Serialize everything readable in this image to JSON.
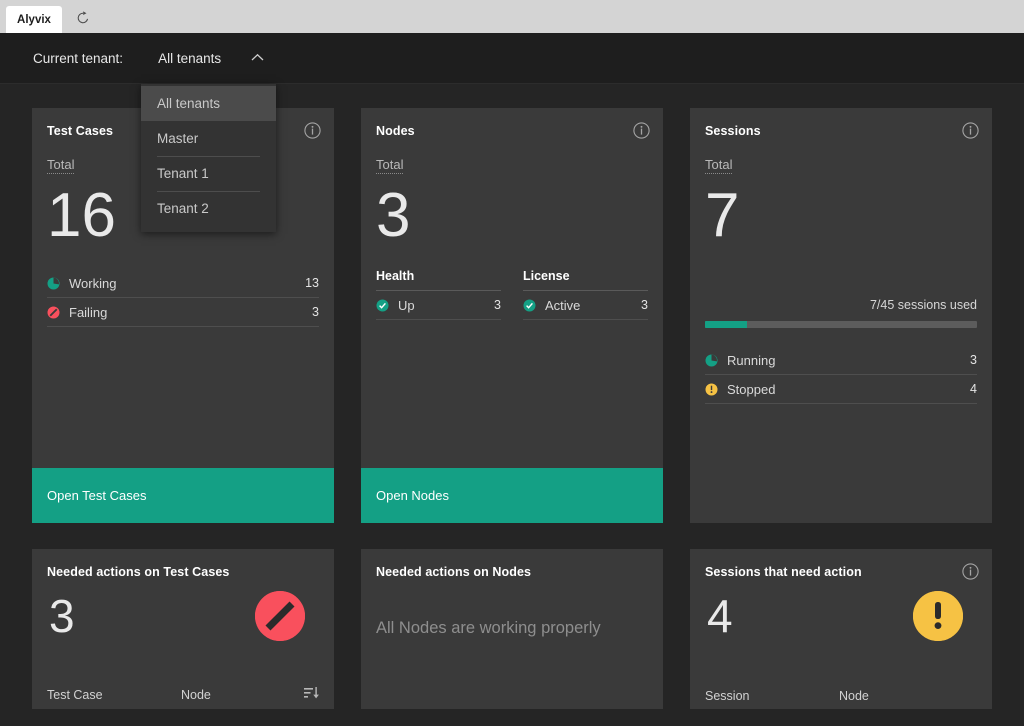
{
  "browser": {
    "tab_title": "Alyvix",
    "reload_icon": "reload-icon"
  },
  "tenant_bar": {
    "label": "Current tenant:",
    "selected": "All tenants",
    "caret_icon": "chevron-up-icon",
    "options": [
      {
        "label": "All tenants",
        "selected": true,
        "divider": false
      },
      {
        "label": "Master",
        "selected": false,
        "divider": false
      },
      {
        "label": "Tenant 1",
        "selected": false,
        "divider": true
      },
      {
        "label": "Tenant 2",
        "selected": false,
        "divider": true
      }
    ]
  },
  "colors": {
    "accent": "#14a085",
    "danger": "#f9505d",
    "warning": "#f6c244",
    "page_bg": "#252525",
    "card_bg": "#3a3a3a",
    "bar_bg": "#1e1e1e"
  },
  "cards": {
    "test_cases": {
      "title": "Test Cases",
      "info_icon": "info-icon",
      "total_label": "Total",
      "total_value": "16",
      "stats": [
        {
          "icon": "pie-working-icon",
          "label": "Working",
          "value": "13"
        },
        {
          "icon": "blocked-icon",
          "label": "Failing",
          "value": "3"
        }
      ],
      "action_label": "Open Test Cases"
    },
    "nodes": {
      "title": "Nodes",
      "info_icon": "info-icon",
      "total_label": "Total",
      "total_value": "3",
      "columns": [
        {
          "title": "Health",
          "rows": [
            {
              "icon": "check-circle-icon",
              "label": "Up",
              "value": "3"
            }
          ]
        },
        {
          "title": "License",
          "rows": [
            {
              "icon": "check-circle-icon",
              "label": "Active",
              "value": "3"
            }
          ]
        }
      ],
      "action_label": "Open Nodes"
    },
    "sessions": {
      "title": "Sessions",
      "info_icon": "info-icon",
      "total_label": "Total",
      "total_value": "7",
      "usage_text": "7/45 sessions used",
      "usage_percent": 15.6,
      "stats": [
        {
          "icon": "pie-running-icon",
          "label": "Running",
          "value": "3"
        },
        {
          "icon": "warning-icon",
          "label": "Stopped",
          "value": "4"
        }
      ]
    },
    "needed_test_cases": {
      "title": "Needed actions on Test Cases",
      "count": "3",
      "badge_icon": "blocked-badge-icon",
      "headers": [
        "Test Case",
        "Node"
      ],
      "sort_icon": "sort-descending-icon"
    },
    "needed_nodes": {
      "title": "Needed actions on Nodes",
      "empty_message": "All Nodes are working properly"
    },
    "sessions_action": {
      "title": "Sessions that need action",
      "info_icon": "info-icon",
      "count": "4",
      "badge_icon": "warning-badge-icon",
      "headers": [
        "Session",
        "Node"
      ]
    }
  }
}
